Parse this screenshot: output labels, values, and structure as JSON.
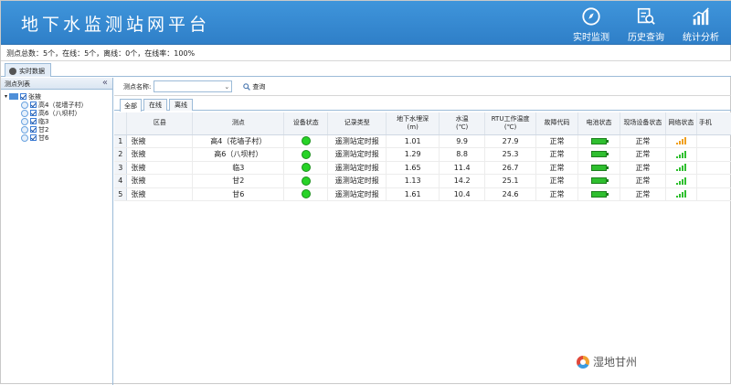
{
  "app": {
    "title": "地下水监测站网平台"
  },
  "nav": [
    {
      "label": "实时监测",
      "icon": "compass-icon"
    },
    {
      "label": "历史查询",
      "icon": "history-search-icon"
    },
    {
      "label": "统计分析",
      "icon": "bar-chart-icon"
    }
  ],
  "status": {
    "summary": "测点总数：5个，在线：5个，离线：0个，在线率：100%"
  },
  "tabs": {
    "realtime": "实时数据"
  },
  "sidebar": {
    "title": "测点列表",
    "collapse_glyph": "«",
    "root": "张掖",
    "items": [
      "高4（花墙子村）",
      "高6（八坝村）",
      "临3",
      "甘2",
      "甘6"
    ]
  },
  "search": {
    "label": "测点名称:",
    "value": "",
    "query_label": "查询"
  },
  "filter_tabs": [
    "全部",
    "在线",
    "离线"
  ],
  "table": {
    "headers": [
      "区县",
      "测点",
      "设备状态",
      "记录类型",
      "地下水埋深(m)",
      "水温(℃)",
      "RTU工作温度(℃)",
      "故障代码",
      "电池状态",
      "现场设备状态",
      "网络状态",
      "手机"
    ],
    "rows": [
      {
        "num": "1",
        "county": "张掖",
        "station": "高4（花墙子村）",
        "device_status": "online",
        "record_type": "遥测站定时报",
        "depth": "1.01",
        "water_temp": "9.9",
        "rtu_temp": "27.9",
        "fault": "正常",
        "battery": "full",
        "site_status": "正常",
        "network": "medium"
      },
      {
        "num": "2",
        "county": "张掖",
        "station": "高6（八坝村）",
        "device_status": "online",
        "record_type": "遥测站定时报",
        "depth": "1.29",
        "water_temp": "8.8",
        "rtu_temp": "25.3",
        "fault": "正常",
        "battery": "full",
        "site_status": "正常",
        "network": "strong"
      },
      {
        "num": "3",
        "county": "张掖",
        "station": "临3",
        "device_status": "online",
        "record_type": "遥测站定时报",
        "depth": "1.65",
        "water_temp": "11.4",
        "rtu_temp": "26.7",
        "fault": "正常",
        "battery": "full",
        "site_status": "正常",
        "network": "strong"
      },
      {
        "num": "4",
        "county": "张掖",
        "station": "甘2",
        "device_status": "online",
        "record_type": "遥测站定时报",
        "depth": "1.13",
        "water_temp": "14.2",
        "rtu_temp": "25.1",
        "fault": "正常",
        "battery": "full",
        "site_status": "正常",
        "network": "strong"
      },
      {
        "num": "5",
        "county": "张掖",
        "station": "甘6",
        "device_status": "online",
        "record_type": "遥测站定时报",
        "depth": "1.61",
        "water_temp": "10.4",
        "rtu_temp": "24.6",
        "fault": "正常",
        "battery": "full",
        "site_status": "正常",
        "network": "strong"
      }
    ]
  },
  "colors": {
    "header_blue": "#3a8ed6",
    "status_green": "#27d327",
    "signal_orange": "#f0a020",
    "signal_green": "#2fbf2f"
  },
  "watermark": {
    "text": "湿地甘州"
  }
}
